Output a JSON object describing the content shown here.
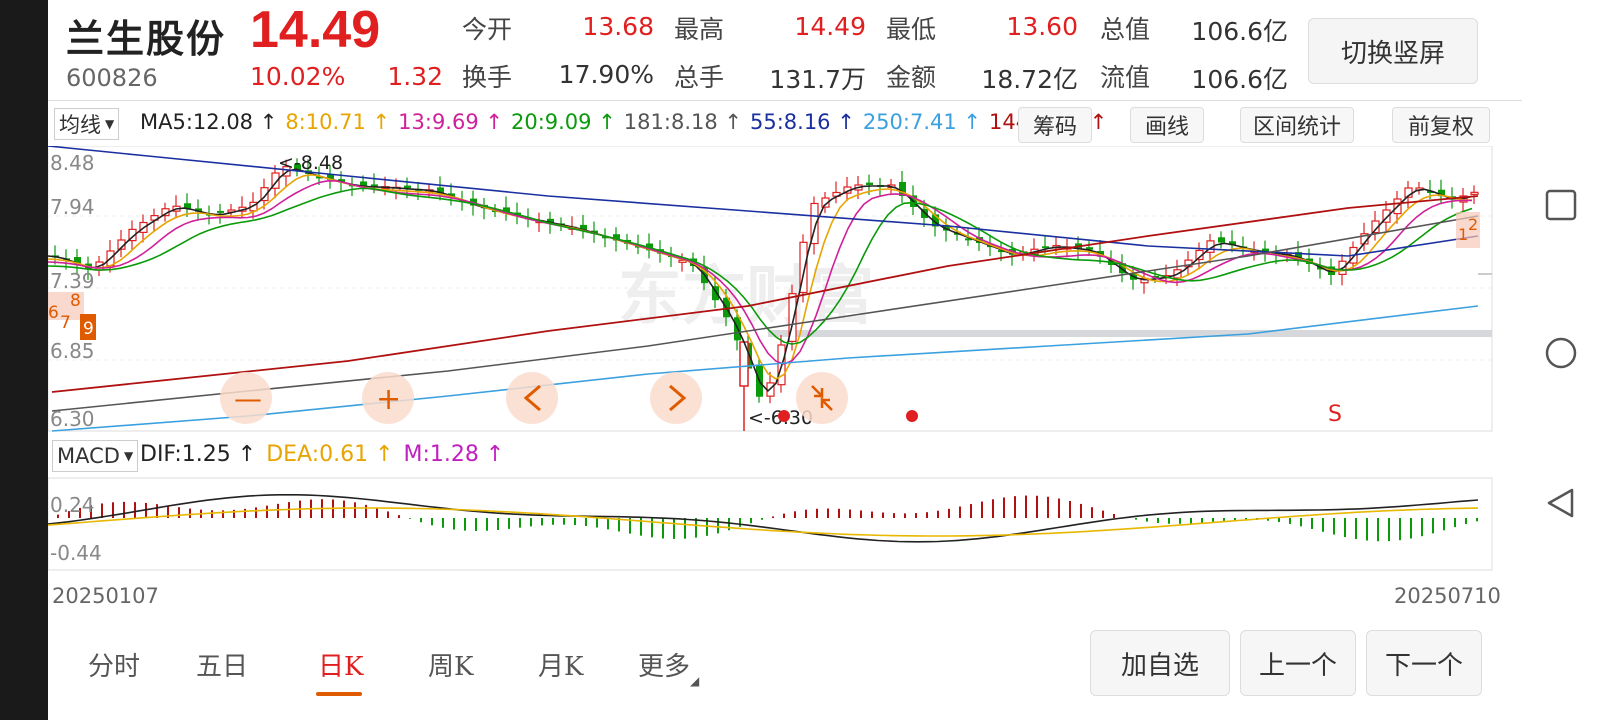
{
  "stock": {
    "name": "兰生股份",
    "code": "600826",
    "price": "14.49",
    "change_pct": "10.02%",
    "change": "1.32"
  },
  "quote": [
    {
      "label": "今开",
      "value": "13.68",
      "color": "#e02020"
    },
    {
      "label": "最高",
      "value": "14.49",
      "color": "#e02020"
    },
    {
      "label": "最低",
      "value": "13.60",
      "color": "#e02020"
    },
    {
      "label": "总值",
      "value": "106.6亿",
      "color": "#333333"
    },
    {
      "label": "换手",
      "value": "17.90%",
      "color": "#333333"
    },
    {
      "label": "总手",
      "value": "131.7万",
      "color": "#333333"
    },
    {
      "label": "金额",
      "value": "18.72亿",
      "color": "#333333"
    },
    {
      "label": "流值",
      "value": "106.6亿",
      "color": "#333333"
    }
  ],
  "switch_label": "切换竖屏",
  "indicator": {
    "select": "均线",
    "ma": [
      {
        "text": "MA5:12.08 ↑",
        "color": "#222222"
      },
      {
        "text": "8:10.71 ↑",
        "color": "#e8a400"
      },
      {
        "text": "13:9.69 ↑",
        "color": "#d0209a"
      },
      {
        "text": "20:9.09 ↑",
        "color": "#0a9a0a"
      },
      {
        "text": "181:8.18 ↑",
        "color": "#555555"
      },
      {
        "text": "55:8.16 ↑",
        "color": "#1a2fa0"
      },
      {
        "text": "250:7.41 ↑",
        "color": "#3ba0e0"
      },
      {
        "text": "144:8.10 ↑",
        "color": "#b01010"
      }
    ],
    "tools": [
      "筹码",
      "画线",
      "区间统计",
      "前复权"
    ]
  },
  "chart_data": {
    "type": "candlestick",
    "y_labels": [
      "8.48",
      "7.94",
      "7.39",
      "6.85",
      "6.30"
    ],
    "high_marker": "<-8.48",
    "low_marker": "<-6.30",
    "signal": "S",
    "left_numbers": [
      "6",
      "7",
      "8",
      "9"
    ],
    "right_numbers": [
      "1",
      "2"
    ],
    "date_start": "20250107",
    "date_end": "20250710"
  },
  "macd": {
    "select": "MACD",
    "dif": {
      "text": "DIF:1.25 ↑",
      "color": "#222222"
    },
    "dea": {
      "text": "DEA:0.61 ↑",
      "color": "#e8a400"
    },
    "m": {
      "text": "M:1.28 ↑",
      "color": "#c020c0"
    },
    "y_labels": [
      "0.24",
      "-0.44"
    ]
  },
  "tabs": [
    {
      "label": "分时"
    },
    {
      "label": "五日"
    },
    {
      "label": "日K"
    },
    {
      "label": "周K"
    },
    {
      "label": "月K"
    },
    {
      "label": "更多"
    }
  ],
  "buttons": [
    "加自选",
    "上一个",
    "下一个"
  ],
  "nav_icons": [
    "square-icon",
    "circle-icon",
    "triangle-back-icon"
  ]
}
